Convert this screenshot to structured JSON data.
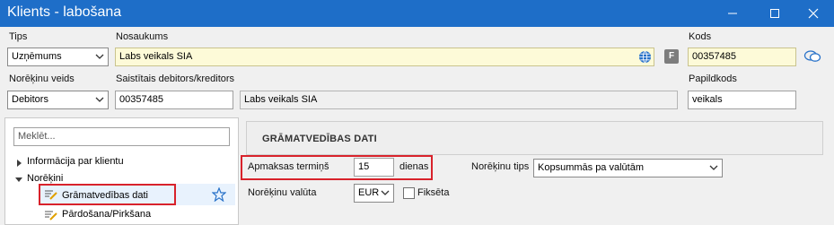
{
  "window": {
    "title": "Klients - labošana",
    "minimize_label": "—",
    "maximize_label": "☐",
    "close_label": "✕"
  },
  "form": {
    "tips_label": "Tips",
    "tips_value": "Uzņēmums",
    "nosaukums_label": "Nosaukums",
    "nosaukums_value": "Labs veikals SIA",
    "f_badge": "F",
    "kods_label": "Kods",
    "kods_value": "00357485",
    "noreķinu_veids_label": "Norēķinu veids",
    "noreķinu_veids_value": "Debitors",
    "saistitais_label": "Saistītais debitors/kreditors",
    "saistitais_code": "00357485",
    "saistitais_name": "Labs veikals SIA",
    "papildkods_label": "Papildkods",
    "papildkods_value": "veikals"
  },
  "tree": {
    "search_placeholder": "Meklēt...",
    "items": [
      {
        "label": "Informācija par klientu"
      },
      {
        "label": "Norēķini"
      },
      {
        "label": "Grāmatvedības dati"
      },
      {
        "label": "Pārdošana/Pirkšana"
      }
    ]
  },
  "section": {
    "title": "GRĀMATVEDĪBAS DATI",
    "apmaksas_label": "Apmaksas termiņš",
    "apmaksas_value": "15",
    "apmaksas_unit": "dienas",
    "noreķinu_tips_label": "Norēķinu tips",
    "noreķinu_tips_value": "Kopsummās pa valūtām",
    "valuta_label": "Norēķinu valūta",
    "valuta_value": "EUR",
    "fikseta_label": "Fiksēta"
  },
  "colors": {
    "titlebar": "#1e6ec8",
    "highlight": "#d8222b",
    "required_field": "#fdfad8"
  }
}
